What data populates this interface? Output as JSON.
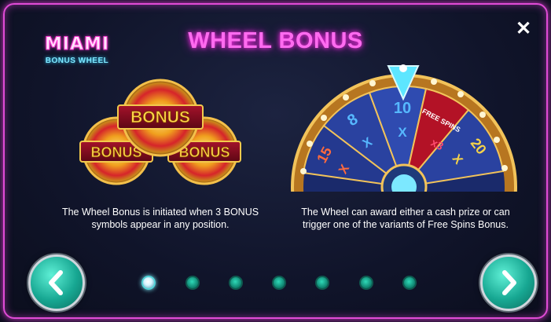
{
  "dialog": {
    "title": "WHEEL BONUS",
    "close_label": "✕"
  },
  "logo": {
    "line1": "MIAMI",
    "line2": "BONUS WHEEL"
  },
  "bonus_symbols": {
    "coin_label": "BONUS"
  },
  "wheel": {
    "segments": [
      "15",
      "X",
      "8",
      "X",
      "10",
      "X",
      "FREE SPINS",
      "x3",
      "20",
      "X"
    ]
  },
  "descriptions": {
    "left": "The Wheel Bonus is initiated when 3 BONUS symbols appear in any position.",
    "right": "The Wheel can award either a cash prize or can trigger one of the variants of Free Spins Bonus."
  },
  "pagination": {
    "total_pages": 7,
    "current_page": 1
  },
  "colors": {
    "title_pink": "#ff6bf0",
    "frame_pink": "#e04bd6",
    "teal_button": "#17a792"
  }
}
